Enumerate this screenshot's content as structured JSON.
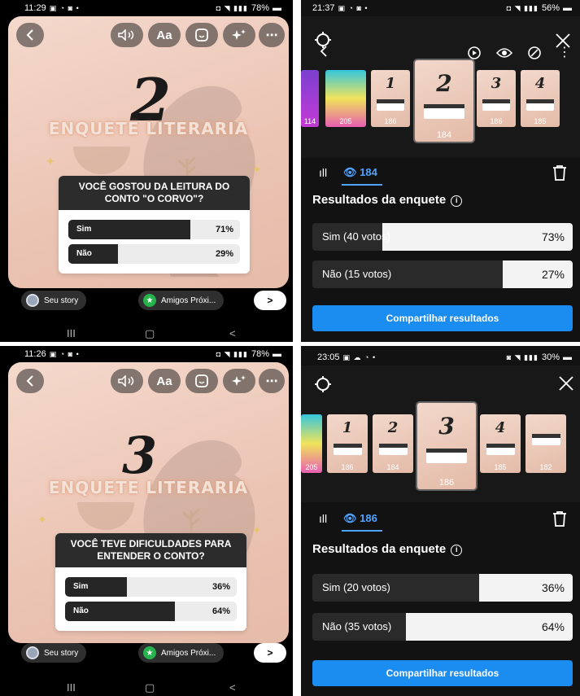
{
  "panel1": {
    "status_time": "11:29",
    "status_battery": "78%",
    "topbar": {
      "text_label": "Aa"
    },
    "story_number": "2",
    "story_heading": "ENQUETE LITERARIA",
    "poll": {
      "question": "VOCÊ GOSTOU DA LEITURA DO CONTO \"O CORVO\"?",
      "options": [
        {
          "label": "Sim",
          "percent_text": "71%",
          "fraction": 0.71
        },
        {
          "label": "Não",
          "percent_text": "29%",
          "fraction": 0.29
        }
      ]
    },
    "bottom": {
      "your_story": "Seu story",
      "close_friends": "Amigos Próxi..."
    }
  },
  "panel2": {
    "status_time": "21:37",
    "status_battery": "56%",
    "thumbnails": [
      {
        "number": "",
        "views": "114",
        "style": "purple"
      },
      {
        "number": "",
        "views": "205",
        "style": "colorful"
      },
      {
        "number": "1",
        "views": "186",
        "style": "normal"
      },
      {
        "number": "2",
        "views": "184",
        "style": "current"
      },
      {
        "number": "3",
        "views": "186",
        "style": "normal"
      },
      {
        "number": "4",
        "views": "185",
        "style": "normal"
      }
    ],
    "views_count": "184",
    "results_title": "Resultados da enquete",
    "results": [
      {
        "label": "Sim (40 votos)",
        "percent_text": "73%",
        "fraction": 0.73
      },
      {
        "label": "Não (15 votos)",
        "percent_text": "27%",
        "fraction": 0.27
      }
    ],
    "share_label": "Compartilhar resultados"
  },
  "panel3": {
    "status_time": "11:26",
    "status_battery": "78%",
    "topbar": {
      "text_label": "Aa"
    },
    "story_number": "3",
    "story_heading": "ENQUETE LITERARIA",
    "poll": {
      "question": "VOCÊ TEVE DIFICULDADES PARA ENTENDER O CONTO?",
      "options": [
        {
          "label": "Sim",
          "percent_text": "36%",
          "fraction": 0.36
        },
        {
          "label": "Não",
          "percent_text": "64%",
          "fraction": 0.64
        }
      ]
    },
    "bottom": {
      "your_story": "Seu story",
      "close_friends": "Amigos Próxi..."
    }
  },
  "panel4": {
    "status_time": "23:05",
    "status_battery": "30%",
    "thumbnails": [
      {
        "number": "",
        "views": "205",
        "style": "colorful"
      },
      {
        "number": "1",
        "views": "186",
        "style": "normal"
      },
      {
        "number": "2",
        "views": "184",
        "style": "normal"
      },
      {
        "number": "3",
        "views": "186",
        "style": "current"
      },
      {
        "number": "4",
        "views": "185",
        "style": "normal"
      },
      {
        "number": "",
        "views": "182",
        "style": "normal"
      }
    ],
    "views_count": "186",
    "results_title": "Resultados da enquete",
    "results": [
      {
        "label": "Sim (20 votos)",
        "percent_text": "36%",
        "fraction": 0.36
      },
      {
        "label": "Não (35 votos)",
        "percent_text": "64%",
        "fraction": 0.64
      }
    ],
    "share_label": "Compartilhar resultados"
  },
  "colors": {
    "story_bg": "#ecc5b5",
    "poll_dark": "#262626",
    "accent_blue": "#1b8cf0",
    "views_blue": "#4ea3ff"
  },
  "icons": [
    "back-icon",
    "sound-icon",
    "sticker-icon",
    "effects-icon",
    "more-icon",
    "settings-icon",
    "close-icon",
    "eye-icon",
    "trash-icon",
    "bar-chart-icon"
  ]
}
